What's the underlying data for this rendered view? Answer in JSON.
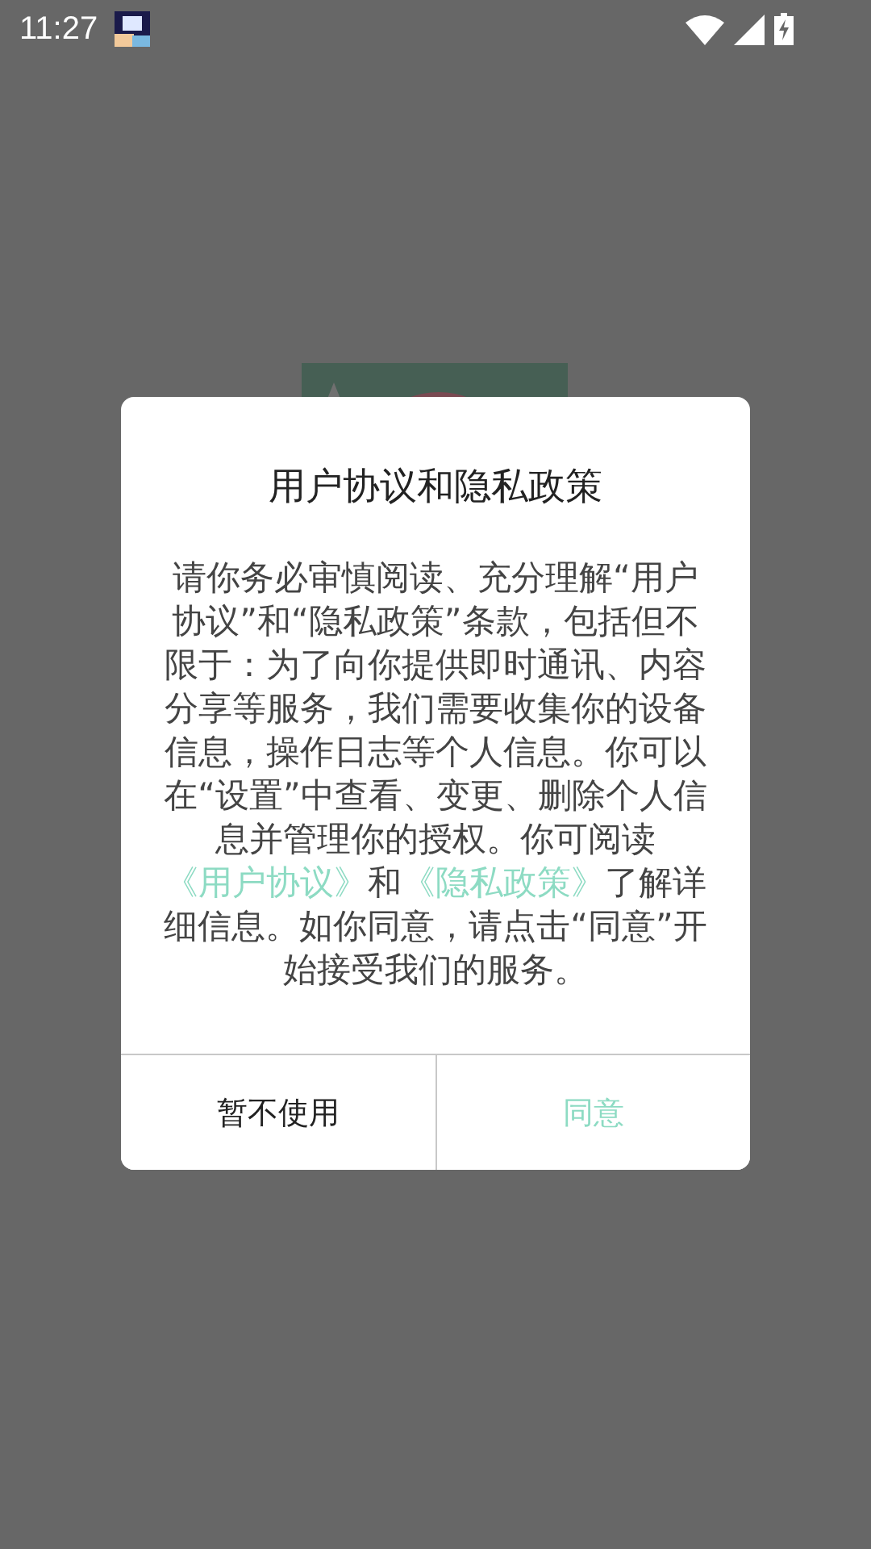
{
  "status_bar": {
    "time": "11:27"
  },
  "dialog": {
    "title": "用户协议和隐私政策",
    "body": [
      {
        "kind": "text",
        "text": "请你务必审慎阅读、充分理解“用户协议”和“隐私政策”条款，包括但不限于：为了向你提供即时通讯、内容分享等服务，我们需要收集你的设备信息，操作日志等个人信息。你可以在“设置”中查看、变更、删除个人信息并管理你的授权。你可阅读"
      },
      {
        "kind": "link",
        "text": "《用户协议》"
      },
      {
        "kind": "text",
        "text": "和"
      },
      {
        "kind": "link",
        "text": "《隐私政策》"
      },
      {
        "kind": "text",
        "text": "了解详细信息。如你同意，请点击“同意”开始接受我们的服务。"
      }
    ],
    "buttons": [
      {
        "label": "暂不使用",
        "kind": "secondary"
      },
      {
        "label": "同意",
        "kind": "primary"
      }
    ]
  }
}
